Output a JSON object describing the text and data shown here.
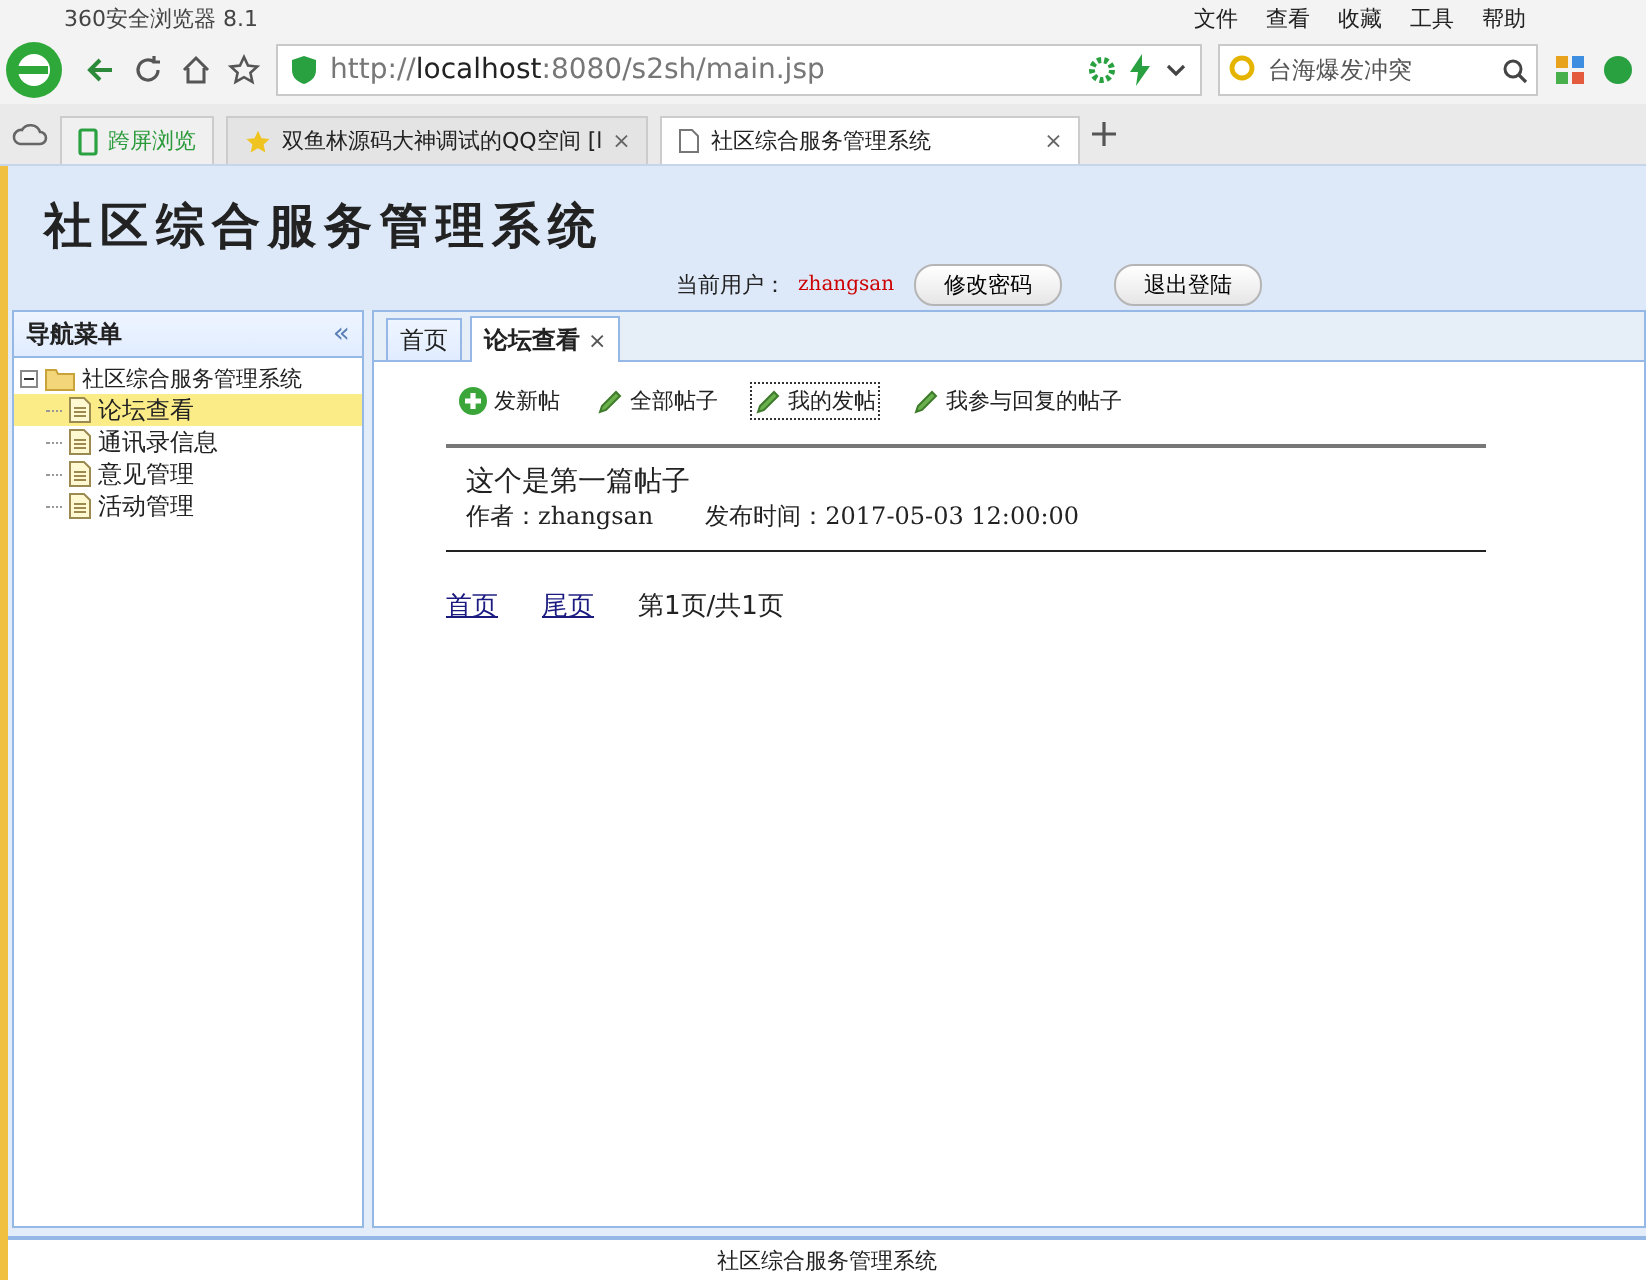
{
  "browser": {
    "title": "360安全浏览器 8.1",
    "menu": [
      "文件",
      "查看",
      "收藏",
      "工具",
      "帮助"
    ],
    "address": {
      "scheme": "http://",
      "host": "localhost",
      "rest": ":8080/s2sh/main.jsp"
    },
    "search": {
      "value": "台海爆发冲突"
    },
    "tabs": [
      {
        "label": "跨屏浏览",
        "kind": "pinned",
        "selected": false
      },
      {
        "label": "双鱼林源码大神调试的QQ空间 [l",
        "kind": "page",
        "selected": false
      },
      {
        "label": "社区综合服务管理系统",
        "kind": "page",
        "selected": true
      }
    ]
  },
  "app": {
    "title": "社区综合服务管理系统",
    "user_label": "当前用户：",
    "user": "zhangsan",
    "buttons": [
      "修改密码",
      "退出登陆"
    ]
  },
  "sidebar": {
    "title": "导航菜单",
    "collapse": "«",
    "tree": {
      "label": "社区综合服务管理系统",
      "expanded": true,
      "children": [
        {
          "label": "论坛查看",
          "selected": true
        },
        {
          "label": "通讯录信息",
          "selected": false
        },
        {
          "label": "意见管理",
          "selected": false
        },
        {
          "label": "活动管理",
          "selected": false
        }
      ]
    }
  },
  "tabs": [
    {
      "label": "首页",
      "selected": false,
      "closable": false
    },
    {
      "label": "论坛查看",
      "selected": true,
      "closable": true
    }
  ],
  "close_glyph": "×",
  "toolbar": [
    {
      "label": "发新帖",
      "kind": "add",
      "focused": false
    },
    {
      "label": "全部帖子",
      "kind": "edit",
      "focused": false
    },
    {
      "label": "我的发帖",
      "kind": "edit",
      "focused": true
    },
    {
      "label": "我参与回复的帖子",
      "kind": "edit",
      "focused": false
    }
  ],
  "posts": [
    {
      "title": "这个是第一篇帖子",
      "author_label": "作者：",
      "author": "zhangsan",
      "time_label": "发布时间：",
      "time": "2017-05-03 12:00:00"
    }
  ],
  "pager": {
    "links": [
      "首页",
      "尾页"
    ],
    "info": "第1页/共1页"
  },
  "footer": "社区综合服务管理系统"
}
